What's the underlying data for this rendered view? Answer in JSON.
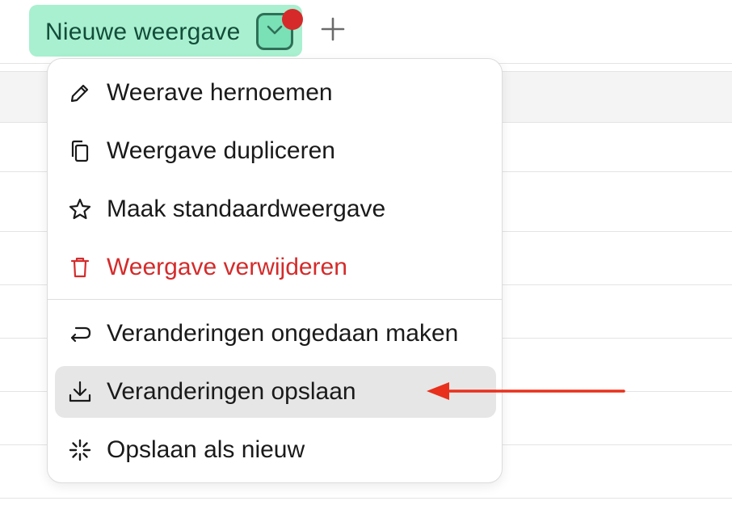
{
  "tab": {
    "label": "Nieuwe weergave",
    "toggle_icon": "chevron-down-icon",
    "has_notification": true,
    "add_icon": "plus-icon"
  },
  "menu": {
    "items": [
      {
        "label": "Weerave hernoemen",
        "icon": "pencil-icon"
      },
      {
        "label": "Weergave dupliceren",
        "icon": "copy-icon"
      },
      {
        "label": "Maak standaardweergave",
        "icon": "star-icon"
      },
      {
        "label": "Weergave verwijderen",
        "icon": "trash-icon",
        "danger": true
      },
      {
        "label": "Veranderingen ongedaan maken",
        "icon": "undo-icon"
      },
      {
        "label": "Veranderingen opslaan",
        "icon": "download-icon",
        "highlighted": true
      },
      {
        "label": "Opslaan als nieuw",
        "icon": "sparkle-icon"
      }
    ]
  },
  "colors": {
    "tab_bg": "#a8f0cf",
    "tab_text": "#134d3a",
    "danger": "#d42b2b",
    "highlight_bg": "#e6e6e6",
    "arrow": "#e8301c",
    "notification": "#d62a2a"
  }
}
